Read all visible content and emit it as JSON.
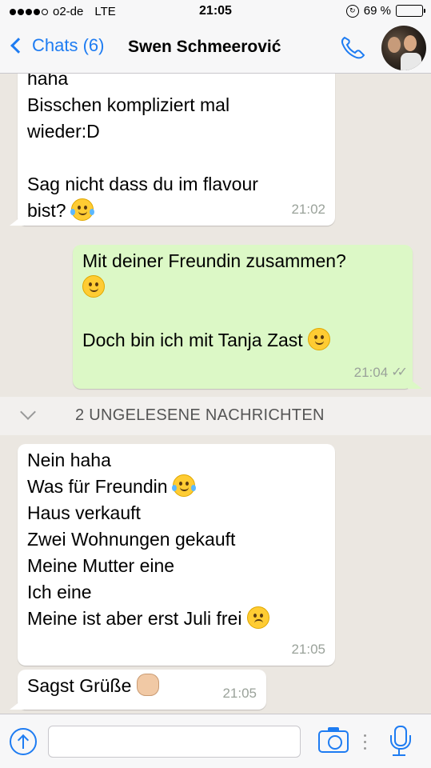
{
  "status_bar": {
    "carrier": "o2-de",
    "network": "LTE",
    "time": "21:05",
    "battery_percent": "69 %",
    "battery_level": 0.69
  },
  "nav": {
    "back_label": "Chats (6)",
    "contact_name": "Swen Schmeerović"
  },
  "messages": [
    {
      "direction": "in",
      "lines": [
        "haha",
        "Bisschen kompliziert mal",
        "wieder:D",
        "",
        "Sag nicht dass du im flavour",
        "bist?"
      ],
      "emoji": "joy-emoji",
      "time": "21:02"
    },
    {
      "direction": "out",
      "lines": [
        "Mit deiner Freundin zusammen?",
        "",
        "",
        "Doch bin ich mit Tanja Zast"
      ],
      "emojis": [
        "smile-emoji",
        "wink-emoji"
      ],
      "time": "21:04",
      "status": "read"
    },
    {
      "direction": "in",
      "lines": [
        "Nein haha",
        "Was für Freundin",
        "Haus verkauft",
        "Zwei Wohnungen gekauft",
        "Meine Mutter eine",
        "Ich eine",
        "Meine ist aber erst Juli frei"
      ],
      "emojis": [
        "joy-emoji",
        "weary-emoji"
      ],
      "time": "21:05"
    },
    {
      "direction": "in",
      "lines": [
        "Sagst Grüße"
      ],
      "emoji": "ok-hand-emoji",
      "time": "21:05"
    }
  ],
  "unread_banner": "2 UNGELESENE NACHRICHTEN",
  "input": {
    "placeholder": ""
  },
  "colors": {
    "accent": "#1e7cf2",
    "outgoing_bubble": "#dcf8c6",
    "incoming_bubble": "#ffffff",
    "chat_background": "#ebe7e1"
  }
}
